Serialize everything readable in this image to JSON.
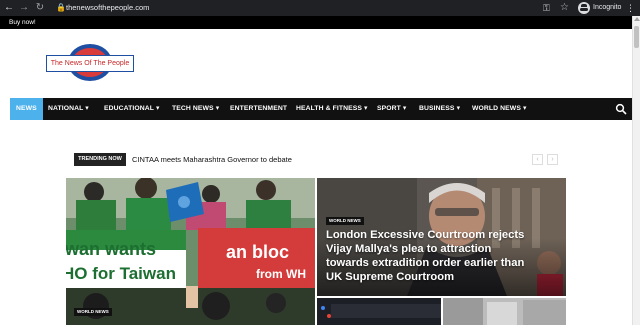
{
  "browser": {
    "url": "thenewsofthepeople.com",
    "profile_label": "Incognito"
  },
  "topbar": {
    "buy_label": "Buy now!"
  },
  "site": {
    "logo_text": "The News Of The People"
  },
  "nav": {
    "items": [
      {
        "label": "NEWS",
        "active": true
      },
      {
        "label": "NATIONAL",
        "dropdown": true
      },
      {
        "label": "EDUCATIONAL",
        "dropdown": true
      },
      {
        "label": "TECH NEWS",
        "dropdown": true
      },
      {
        "label": "ENTERTENMENT"
      },
      {
        "label": "HEALTH & FITNESS",
        "dropdown": true
      },
      {
        "label": "SPORT",
        "dropdown": true
      },
      {
        "label": "BUSINESS",
        "dropdown": true
      },
      {
        "label": "WORLD NEWS",
        "dropdown": true
      }
    ],
    "accent": "#4db2ec"
  },
  "trending": {
    "label": "TRENDING NOW",
    "headline": "CINTAA meets Maharashtra Governor to debate"
  },
  "featured": {
    "main": {
      "category": "WORLD NEWS",
      "photo_signs": [
        "iwan wants",
        "HO for Taiwan",
        "an bloc",
        "from WH"
      ]
    },
    "side": {
      "category": "WORLD NEWS",
      "headline": "London Excessive Courtroom rejects Vijay Mallya's plea to attraction towards extradition order earlier than UK Supreme Courtroom"
    }
  }
}
